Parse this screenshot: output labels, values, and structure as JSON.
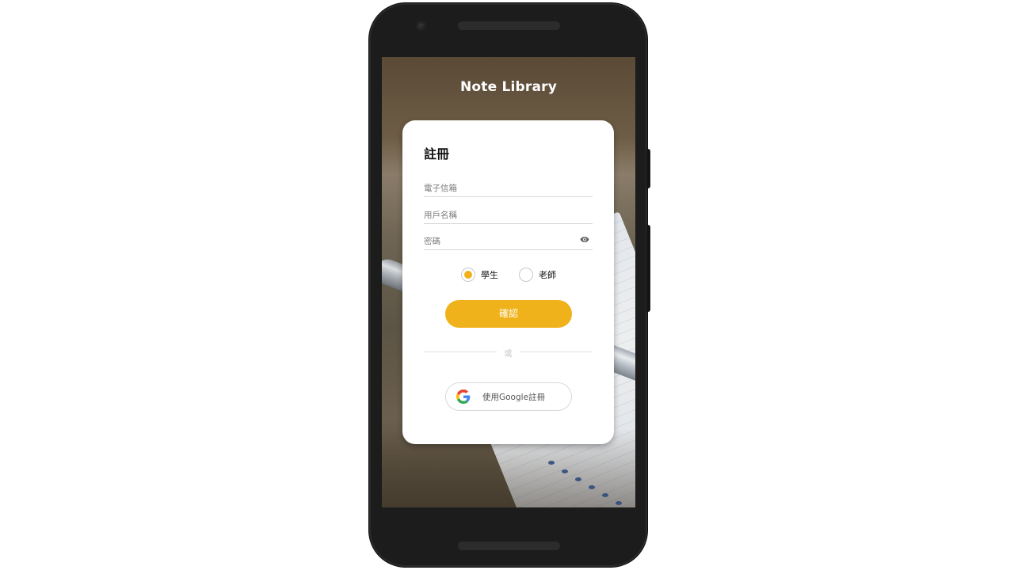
{
  "app": {
    "title": "Note Library"
  },
  "register_card": {
    "title": "註冊",
    "fields": {
      "email_placeholder": "電子信箱",
      "username_placeholder": "用戶名稱",
      "password_placeholder": "密碼"
    },
    "roles": [
      {
        "label": "學生",
        "selected": true
      },
      {
        "label": "老師",
        "selected": false
      }
    ],
    "confirm_label": "確認",
    "divider_label": "或",
    "google_label": "使用Google註冊"
  },
  "colors": {
    "accent": "#f0b21a",
    "card_bg": "#ffffff",
    "title_text": "#ffffff"
  },
  "icons": {
    "password_toggle": "eye-icon",
    "google": "google-g-icon"
  }
}
